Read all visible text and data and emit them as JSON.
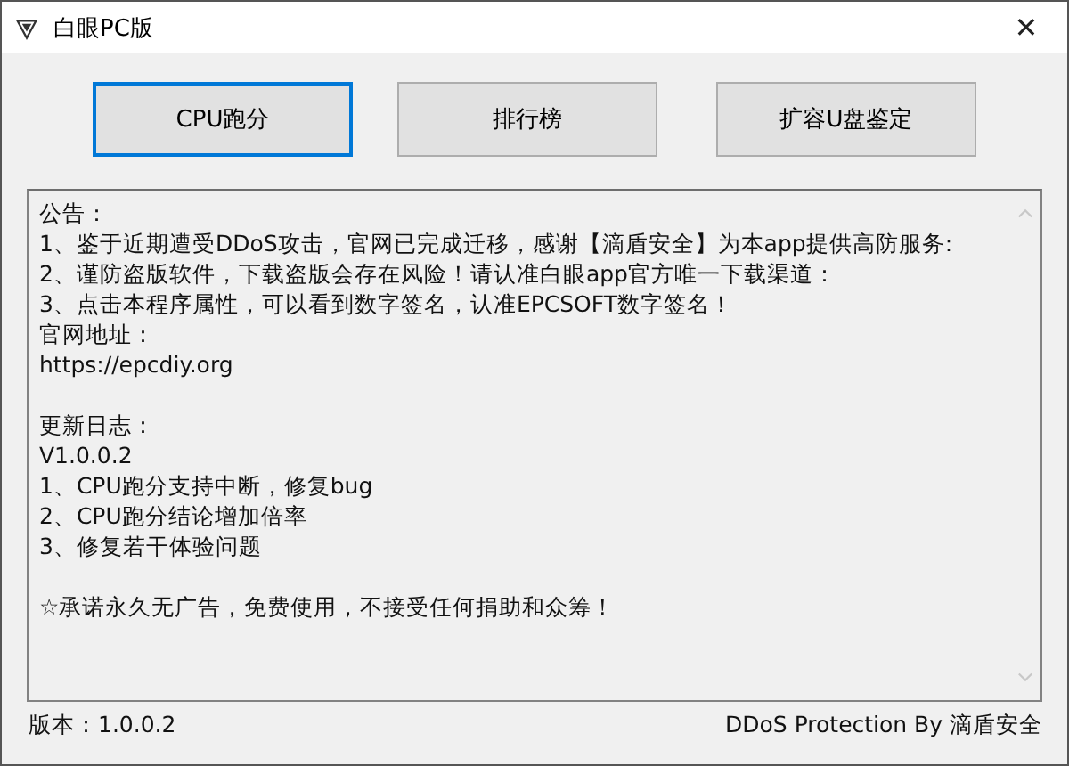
{
  "window": {
    "title": "白眼PC版",
    "close": "✕"
  },
  "buttons": [
    {
      "label": "CPU跑分",
      "selected": true
    },
    {
      "label": "排行榜",
      "selected": false
    },
    {
      "label": "扩容U盘鉴定",
      "selected": false
    }
  ],
  "notice_paragraphs": [
    [
      "公告：",
      "1、鉴于近期遭受DDoS攻击，官网已完成迁移，感谢【滴盾安全】为本app提供高防服务:",
      "2、谨防盗版软件，下载盗版会存在风险！请认准白眼app官方唯一下载渠道：",
      "3、点击本程序属性，可以看到数字签名，认准EPCSOFT数字签名！",
      "官网地址：",
      "https://epcdiy.org"
    ],
    [
      "更新日志：",
      "V1.0.0.2",
      "1、CPU跑分支持中断，修复bug",
      "2、CPU跑分结论增加倍率",
      "3、修复若干体验问题"
    ],
    [
      "☆承诺永久无广告，免费使用，不接受任何捐助和众筹！"
    ]
  ],
  "status_bar": {
    "version": "版本：1.0.0.2",
    "protection": "DDoS Protection By 滴盾安全"
  }
}
